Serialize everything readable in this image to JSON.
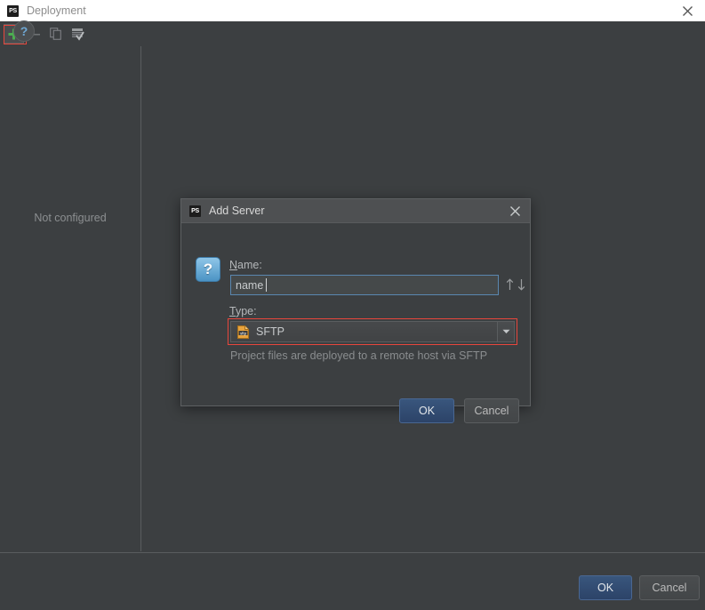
{
  "window": {
    "title": "Deployment",
    "app_badge": "PS",
    "close_icon": "close-icon"
  },
  "toolbar": {
    "items": [
      {
        "name": "add-server-button",
        "icon": "plus-icon",
        "label": "Add"
      },
      {
        "name": "remove-server-button",
        "icon": "minus-icon",
        "label": "Remove"
      },
      {
        "name": "copy-server-button",
        "icon": "copy-icon",
        "label": "Copy"
      },
      {
        "name": "set-default-button",
        "icon": "set-default-icon",
        "label": "Use as default"
      }
    ]
  },
  "left_panel": {
    "empty_text": "Not configured"
  },
  "footer": {
    "help_label": "?",
    "ok_label": "OK",
    "cancel_label": "Cancel"
  },
  "dialog": {
    "title": "Add Server",
    "app_badge": "PS",
    "close_icon": "close-icon",
    "help_icon_label": "?",
    "name": {
      "label": "Name:",
      "mnemonic": "N",
      "rest": "ame:",
      "value": "name",
      "placeholder": "name"
    },
    "sort": {
      "up_icon": "arrow-up-icon",
      "down_icon": "arrow-down-icon",
      "up_glyph": "↑",
      "down_glyph": "↓"
    },
    "type": {
      "label": "Type:",
      "mnemonic": "T",
      "rest": "ype:",
      "value": "SFTP",
      "icon_label": "sftp",
      "hint": "Project files are deployed to a remote host via SFTP"
    },
    "ok_label": "OK",
    "cancel_label": "Cancel"
  },
  "colors": {
    "background": "#3c3f41",
    "titlebar": "#ffffff",
    "dialog_titlebar": "#4e5052",
    "accent_blue": "#2c4368",
    "annotation_red": "#e8463c",
    "sftp_icon_orange": "#e8a33d",
    "add_icon_green": "#4caf50",
    "help_icon_blue": "#4b93c4"
  }
}
